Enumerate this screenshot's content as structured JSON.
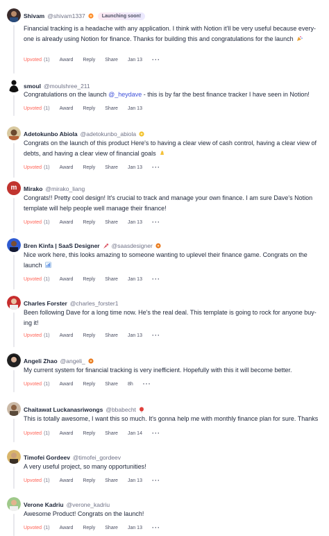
{
  "labels": {
    "upvoted": "Upvoted",
    "award": "Award",
    "reply": "Reply",
    "share": "Share",
    "more": "···"
  },
  "comments": [
    {
      "name": "Shivam",
      "handle": "@shivam1337",
      "badge": "Launching soon!",
      "text": "Financial tracking is a headache with any application. I think with Notion it'll be very useful because every-one is already using Notion for finance. Thanks for building this and congratulations for the launch",
      "upvotes": "(1)",
      "date": "Jan 13"
    },
    {
      "name": "smoul",
      "handle": "@moulshree_211",
      "text_before": "Congratulations on the launch ",
      "mention": "@_heydave",
      "text_after": " - this is by far the best finance tracker I have seen in Notion!",
      "upvotes": "(1)",
      "date": "Jan 13"
    },
    {
      "name": "Adetokunbo Abiola",
      "handle": "@adetokunbo_abiola",
      "text": "Congrats on the launch of this product  Here's to having a clear view of cash control, having a clear view of debts, and having a clear view of financial goals",
      "upvotes": "(1)",
      "date": "Jan 13"
    },
    {
      "name": "Mirako",
      "handle": "@mirako_liang",
      "avatar_letter": "m",
      "text": "Congrats!! Pretty cool design! It's crucial to track and manage your own finance. I am sure Dave's Notion template will help people well manage their finance!",
      "upvotes": "(1)",
      "date": "Jan 13"
    },
    {
      "name": "Bren Kinfa | SaaS Designer",
      "handle": "@saasdesigner",
      "text": "Nice work here, this looks amazing to someone wanting to uplevel their finance game. Congrats on the launch",
      "upvotes": "(1)",
      "date": "Jan 13"
    },
    {
      "name": "Charles Forster",
      "handle": "@charles_forster1",
      "text": "Been following Dave for a long time now. He's the real deal. This template is going to rock for anyone buy-ing it!",
      "upvotes": "(1)",
      "date": "Jan 13"
    },
    {
      "name": "Angeli Zhao",
      "handle": "@angeli_",
      "text": "My current system for financial tracking is very inefficient. Hopefully with this it will become better.",
      "upvotes": "(1)",
      "date": "8h"
    },
    {
      "name": "Chaitawat Luckanasriwongs",
      "handle": "@bbabecht",
      "text": "This is totally awesome, I want this so much. It's gonna help me with monthly finance plan for sure. Thanks",
      "upvotes": "(1)",
      "date": "Jan 14"
    },
    {
      "name": "Timofei Gordeev",
      "handle": "@timofei_gordeev",
      "text": "A very useful project, so many opportunities!",
      "upvotes": "(1)",
      "date": "Jan 13"
    },
    {
      "name": "Verone Kadriu",
      "handle": "@verone_kadriu",
      "text": "Awesome Product! Congrats on the launch!",
      "upvotes": "(1)",
      "date": "Jan 13"
    }
  ],
  "colors": {
    "upvote": "#ff6154",
    "mention": "#3f51d9",
    "text": "#21293c",
    "muted": "#6f7287",
    "thread": "#e8e8ec"
  },
  "icons": {
    "badge": "orange-circle-badge-icon",
    "rocket": "rocket-icon",
    "party": "party-popper-icon",
    "thumbs": "thumbs-up-icon",
    "clap": "clapping-hands-icon",
    "chart": "chart-emoji-icon",
    "balloon": "balloon-icon"
  }
}
